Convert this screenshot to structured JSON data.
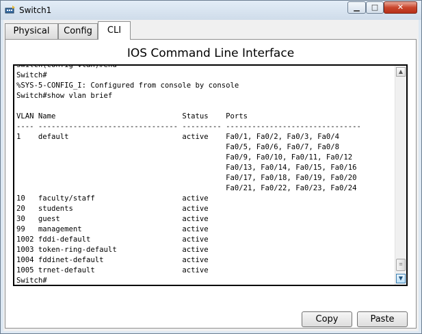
{
  "window": {
    "title": "Switch1",
    "controls": {
      "minimize": "▁",
      "maximize": "□",
      "close": "✕"
    }
  },
  "tabs": [
    {
      "label": "Physical",
      "selected": false
    },
    {
      "label": "Config",
      "selected": false
    },
    {
      "label": "CLI",
      "selected": true
    }
  ],
  "cli": {
    "heading": "IOS Command Line Interface",
    "lines": [
      "Switch(config-vlan)#end",
      "Switch#",
      "%SYS-5-CONFIG_I: Configured from console by console",
      "Switch#show vlan brief",
      "",
      "VLAN Name                             Status    Ports",
      "---- -------------------------------- --------- -------------------------------",
      "1    default                          active    Fa0/1, Fa0/2, Fa0/3, Fa0/4",
      "                                                Fa0/5, Fa0/6, Fa0/7, Fa0/8",
      "                                                Fa0/9, Fa0/10, Fa0/11, Fa0/12",
      "                                                Fa0/13, Fa0/14, Fa0/15, Fa0/16",
      "                                                Fa0/17, Fa0/18, Fa0/19, Fa0/20",
      "                                                Fa0/21, Fa0/22, Fa0/23, Fa0/24",
      "10   faculty/staff                    active",
      "20   students                         active",
      "30   guest                            active",
      "99   management                       active",
      "1002 fddi-default                     active",
      "1003 token-ring-default               active",
      "1004 fddinet-default                  active",
      "1005 trnet-default                    active",
      "Switch#"
    ]
  },
  "buttons": {
    "copy": "Copy",
    "paste": "Paste"
  },
  "icons": {
    "app": "network-switch-icon",
    "scroll_up": "▲",
    "scroll_down": "▼",
    "thumb_grip": "≡"
  },
  "colors": {
    "close_button": "#c9462c",
    "terminal_bg": "#ffffff",
    "terminal_text": "#000000"
  }
}
